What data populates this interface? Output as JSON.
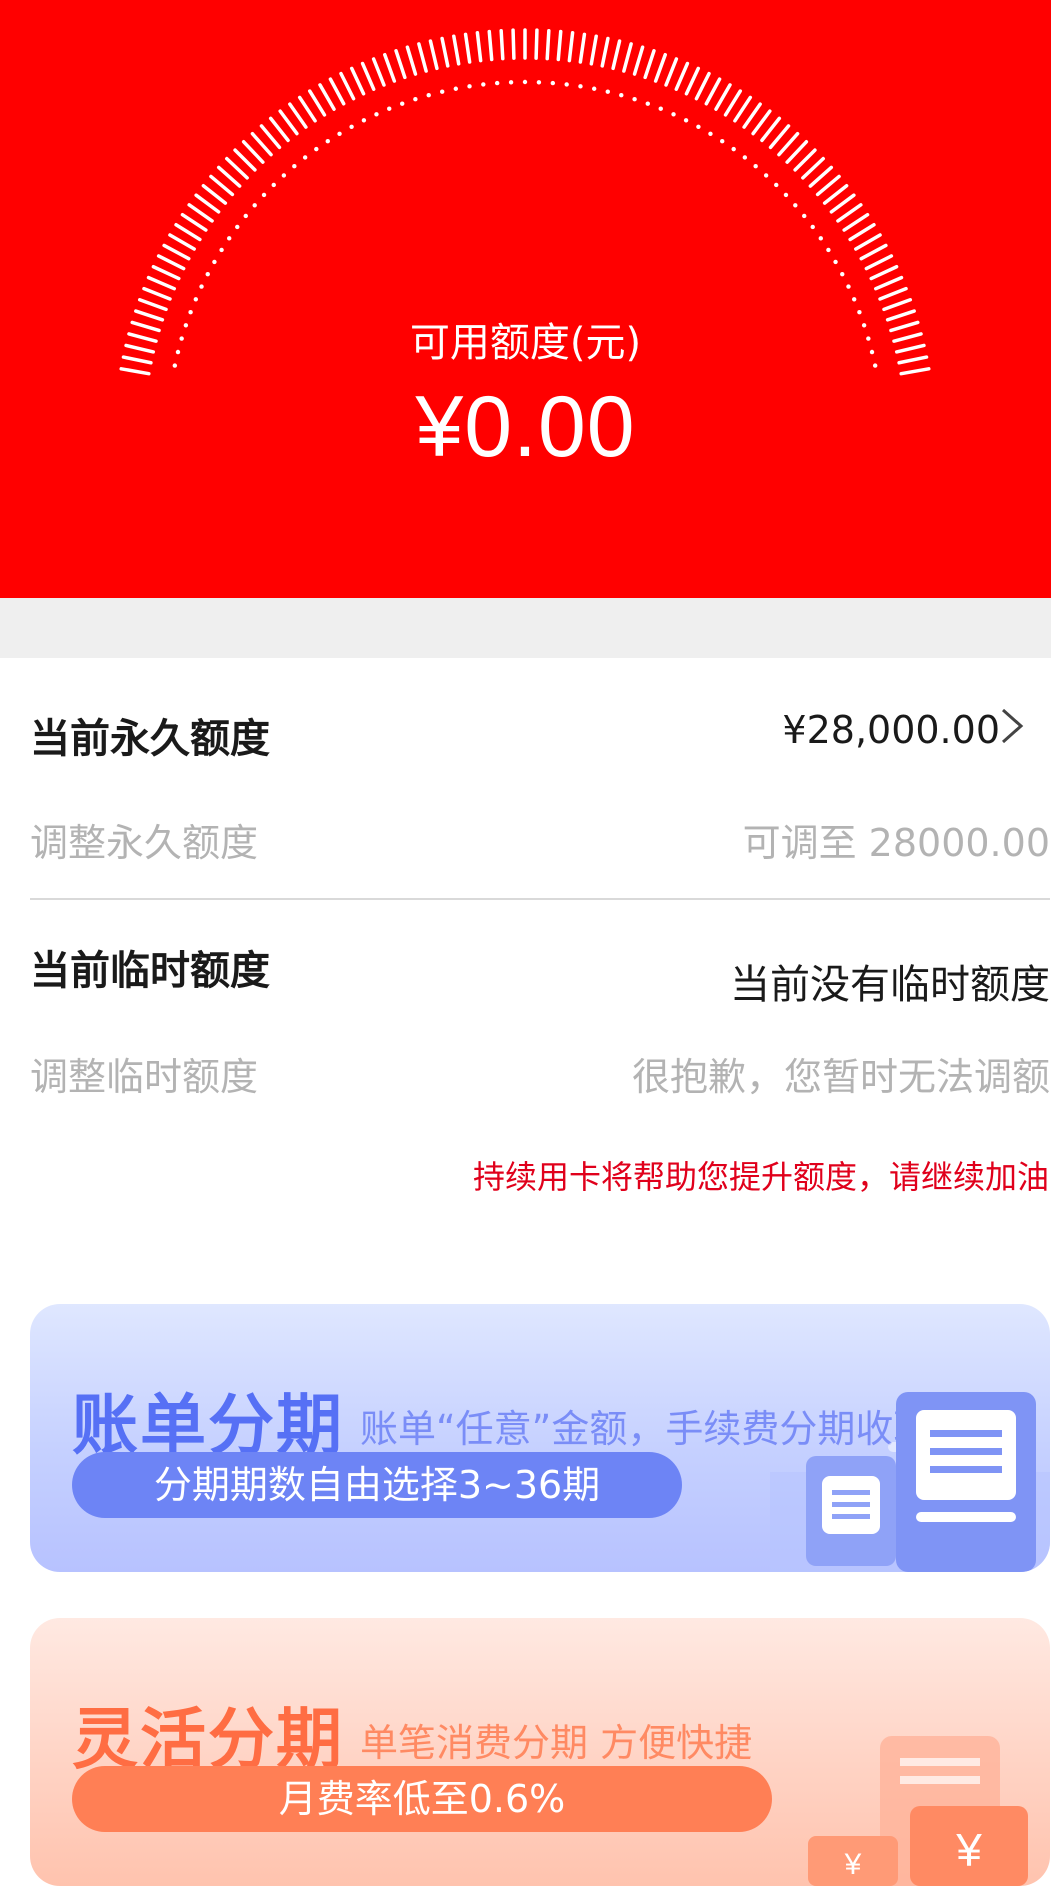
{
  "hero": {
    "label": "可用额度(元)",
    "amount": "¥0.00",
    "colors": {
      "background": "#ff0000",
      "ticks": "#ffffff"
    }
  },
  "permanent": {
    "title": "当前永久额度",
    "value": "¥28,000.00",
    "adjust_label": "调整永久额度",
    "adjust_value": "可调至 28000.00"
  },
  "temporary": {
    "title": "当前临时额度",
    "value": "当前没有临时额度",
    "adjust_label": "调整临时额度",
    "adjust_value": "很抱歉，您暂时无法调额"
  },
  "notice": "持续用卡将帮助您提升额度，请继续加油",
  "cards": [
    {
      "title": "账单分期",
      "desc": "账单“任意”金额，手续费分期收取",
      "pill": "分期期数自由选择3~36期",
      "icon": "document-icon",
      "accent": "#5670f5"
    },
    {
      "title": "灵活分期",
      "desc": "单笔消费分期 方便快捷",
      "pill": "月费率低至0.6%",
      "icon": "yen-icon",
      "accent": "#ff6d43",
      "icon_text": "¥"
    }
  ]
}
